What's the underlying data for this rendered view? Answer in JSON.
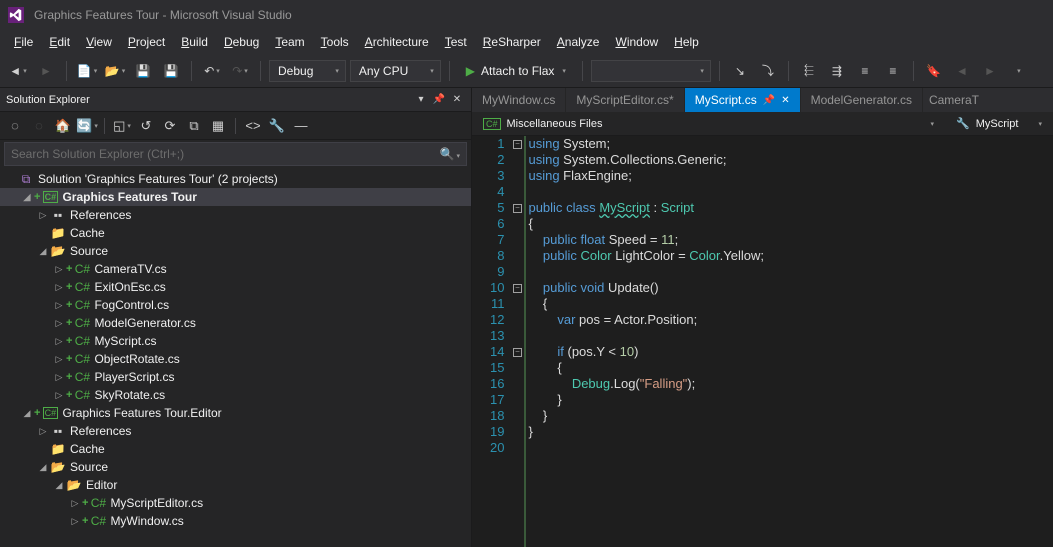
{
  "title": "Graphics Features Tour - Microsoft Visual Studio",
  "menu": [
    "File",
    "Edit",
    "View",
    "Project",
    "Build",
    "Debug",
    "Team",
    "Tools",
    "Architecture",
    "Test",
    "ReSharper",
    "Analyze",
    "Window",
    "Help"
  ],
  "toolbar": {
    "config": "Debug",
    "platform": "Any CPU",
    "start": "Attach to Flax"
  },
  "solutionExplorer": {
    "title": "Solution Explorer",
    "searchPlaceholder": "Search Solution Explorer (Ctrl+;)",
    "solution": "Solution 'Graphics Features Tour' (2 projects)",
    "project1": "Graphics Features Tour",
    "references": "References",
    "cache": "Cache",
    "source": "Source",
    "files1": [
      "CameraTV.cs",
      "ExitOnEsc.cs",
      "FogControl.cs",
      "ModelGenerator.cs",
      "MyScript.cs",
      "ObjectRotate.cs",
      "PlayerScript.cs",
      "SkyRotate.cs"
    ],
    "project2": "Graphics Features Tour.Editor",
    "editorFolder": "Editor",
    "files2": [
      "MyScriptEditor.cs",
      "MyWindow.cs"
    ]
  },
  "tabs": [
    {
      "name": "MyWindow.cs",
      "active": false
    },
    {
      "name": "MyScriptEditor.cs*",
      "active": false
    },
    {
      "name": "MyScript.cs",
      "active": true
    },
    {
      "name": "ModelGenerator.cs",
      "active": false
    },
    {
      "name": "CameraT",
      "active": false,
      "overflow": true
    }
  ],
  "context": {
    "left": "Miscellaneous Files",
    "right": "MyScript"
  },
  "code": [
    {
      "n": 1,
      "f": "-",
      "html": "<span class='kw'>using</span> System;"
    },
    {
      "n": 2,
      "f": "",
      "html": "<span class='kw'>using</span> System.Collections.Generic;"
    },
    {
      "n": 3,
      "f": "",
      "html": "<span class='kw'>using</span> FlaxEngine;"
    },
    {
      "n": 4,
      "f": "",
      "html": ""
    },
    {
      "n": 5,
      "f": "-",
      "html": "<span class='kw'>public</span> <span class='kw'>class</span> <span class='cls und'>MyScript</span> : <span class='cls'>Script</span>"
    },
    {
      "n": 6,
      "f": "",
      "html": "{"
    },
    {
      "n": 7,
      "f": "",
      "html": "    <span class='kw'>public</span> <span class='kw'>float</span> Speed = <span class='num'>11</span>;"
    },
    {
      "n": 8,
      "f": "",
      "html": "    <span class='kw'>public</span> <span class='cls'>Color</span> LightColor = <span class='cls'>Color</span>.Yellow;"
    },
    {
      "n": 9,
      "f": "",
      "html": ""
    },
    {
      "n": 10,
      "f": "-",
      "html": "    <span class='kw'>public</span> <span class='kw'>void</span> Update()"
    },
    {
      "n": 11,
      "f": "",
      "html": "    {"
    },
    {
      "n": 12,
      "f": "",
      "html": "        <span class='kw'>var</span> pos = Actor.Position;"
    },
    {
      "n": 13,
      "f": "",
      "html": ""
    },
    {
      "n": 14,
      "f": "-",
      "html": "        <span class='kw'>if</span> (pos.Y &lt; <span class='num'>10</span>)"
    },
    {
      "n": 15,
      "f": "",
      "html": "        {"
    },
    {
      "n": 16,
      "f": "",
      "html": "            <span class='cls'>Debug</span>.Log(<span class='str'>\"Falling\"</span>);"
    },
    {
      "n": 17,
      "f": "",
      "html": "        }"
    },
    {
      "n": 18,
      "f": "",
      "html": "    }"
    },
    {
      "n": 19,
      "f": "",
      "html": "}"
    },
    {
      "n": 20,
      "f": "",
      "html": ""
    }
  ]
}
